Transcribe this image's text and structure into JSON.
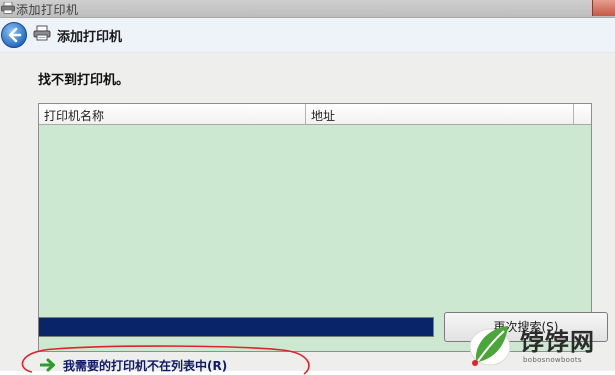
{
  "window": {
    "title": "添加打印机"
  },
  "wizard": {
    "title": "添加打印机",
    "back_icon": "back-arrow-icon",
    "printer_icon": "printer-icon"
  },
  "status": {
    "message": "找不到打印机。"
  },
  "printer_list": {
    "columns": [
      "打印机名称",
      "地址"
    ],
    "rows": []
  },
  "search": {
    "progress": 1.0,
    "button_label": "再次搜索(S)"
  },
  "not_listed": {
    "label": "我需要的打印机不在列表中(R)"
  },
  "watermark": {
    "brand": "饽饽网",
    "site": "bobosnowboots"
  },
  "colors": {
    "list_background": "#cde8d0",
    "progress_fill": "#0a246a",
    "annotation_circle": "#e0242c",
    "link_text": "#0e1a66"
  }
}
